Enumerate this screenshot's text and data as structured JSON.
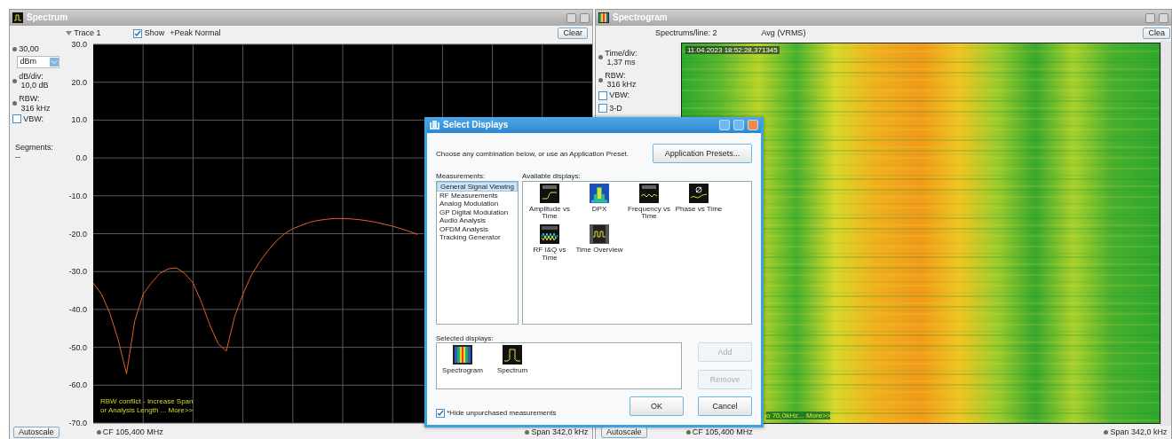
{
  "spectrum": {
    "title": "Spectrum",
    "show": {
      "label": "Show",
      "checked": true
    },
    "trace_mode": "+Peak Normal",
    "clear": "Clear",
    "ref_level": "30,00",
    "unit": "dBm",
    "db_div_label": "dB/div:",
    "db_div": "10,0 dB",
    "rbw_label": "RBW:",
    "rbw": "316 kHz",
    "vbw": {
      "label": "VBW:",
      "checked": false
    },
    "segments_label": "Segments:",
    "segments": "--",
    "warning_lines": [
      "RBW conflict - Increase Span",
      "or Analysis Length ... More>>"
    ],
    "autoscale": "Autoscale",
    "cf": "CF  105,400 MHz",
    "span": "Span 342,0 kHz",
    "chart_data": {
      "type": "line",
      "grid": true,
      "ylim": [
        -70,
        30
      ],
      "yticks": [
        {
          "value": 30,
          "label": "30.0"
        },
        {
          "value": 20,
          "label": "20.0"
        },
        {
          "value": 10,
          "label": "10.0"
        },
        {
          "value": 0,
          "label": "0.0"
        },
        {
          "value": -10,
          "label": "-10.0"
        },
        {
          "value": -20,
          "label": "-20.0"
        },
        {
          "value": -30,
          "label": "-30.0"
        },
        {
          "value": -40,
          "label": "-40.0"
        },
        {
          "value": -50,
          "label": "-50.0"
        },
        {
          "value": -60,
          "label": "-60.0"
        },
        {
          "value": -70,
          "label": "-70.0"
        }
      ],
      "categories": [
        null,
        null,
        null,
        null,
        null,
        null,
        null,
        null,
        null,
        null,
        null,
        null,
        null,
        null,
        null,
        null,
        null,
        null,
        null,
        null,
        null,
        null,
        null,
        null,
        null,
        null,
        null,
        null,
        null,
        null,
        null,
        null,
        null,
        null,
        null,
        null,
        null,
        null,
        null,
        null,
        null,
        null,
        null,
        null,
        null,
        null,
        null,
        null,
        null,
        null,
        null,
        null,
        null,
        null,
        null,
        null,
        null,
        null,
        null,
        null,
        null
      ],
      "series": [
        {
          "name": "Trace 1",
          "color": "#e0622a",
          "values": [
            -33,
            -36,
            -41,
            -48,
            -57,
            -43,
            -36,
            -33,
            -30.5,
            -29.3,
            -29,
            -30.5,
            -33,
            -38,
            -44,
            -49,
            -51,
            -42,
            -36,
            -31,
            -27.5,
            -24.5,
            -22,
            -20,
            -18.7,
            -17.8,
            -17,
            -16.5,
            -16.2,
            -16,
            -16,
            -16.1,
            -16.3,
            -16.6,
            -17,
            -17.5,
            -18,
            -18.7,
            -19.4,
            -20.2,
            null,
            null,
            null,
            null,
            null,
            null,
            null,
            null,
            null,
            null,
            null,
            null,
            null,
            null,
            null,
            null,
            null,
            null,
            null,
            null,
            null
          ]
        }
      ]
    }
  },
  "spectrogram": {
    "title": "Spectrogram",
    "spectrums_per_line": "Spectrums/line: 2",
    "detection": "Avg (VRMS)",
    "clear": "Clea",
    "time_div_label": "Time/div:",
    "time_div": "1,37 ms",
    "rbw_label": "RBW:",
    "rbw": "316 kHz",
    "vbw": {
      "label": "VBW:",
      "checked": false
    },
    "three_d": {
      "label": "3-D",
      "checked": false
    },
    "timestamp": "11.04.2023 18:52:28,371345",
    "message": "o 70,0kHz... More>>",
    "autoscale": "Autoscale",
    "cf": "CF  105,400 MHz",
    "span": "Span 342,0 kHz"
  },
  "dialog": {
    "title": "Select Displays",
    "intro": "Choose any combination below, or use an Application Preset.",
    "presets_button": "Application Presets...",
    "measurements_label": "Measurements:",
    "measurements": [
      {
        "label": "General Signal Viewing",
        "selected": true
      },
      {
        "label": "RF Measurements",
        "selected": false
      },
      {
        "label": "Analog Modulation",
        "selected": false
      },
      {
        "label": "GP Digital Modulation",
        "selected": false
      },
      {
        "label": "Audio Analysis",
        "selected": false
      },
      {
        "label": "OFDM Analysis",
        "selected": false
      },
      {
        "label": "Tracking Generator",
        "selected": false
      }
    ],
    "available_label": "Available displays:",
    "available": [
      {
        "label": "Amplitude vs Time",
        "kind": "ampl"
      },
      {
        "label": "DPX",
        "kind": "dpx"
      },
      {
        "label": "Frequency vs Time",
        "kind": "freq"
      },
      {
        "label": "Phase vs Time",
        "kind": "phase"
      },
      {
        "label": "RF I&Q vs Time",
        "kind": "rfiq"
      },
      {
        "label": "Time Overview",
        "kind": "timeov"
      }
    ],
    "selected_label": "Selected displays:",
    "selected_displays": [
      {
        "label": "Spectrogram",
        "kind": "sgram"
      },
      {
        "label": "Spectrum",
        "kind": "spec"
      }
    ],
    "add": {
      "label": "Add",
      "disabled": true
    },
    "remove": {
      "label": "Remove",
      "disabled": true
    },
    "hide_unpurchased": {
      "label": "*Hide unpurchased measurements",
      "checked": true
    },
    "ok": "OK",
    "cancel": "Cancel"
  }
}
